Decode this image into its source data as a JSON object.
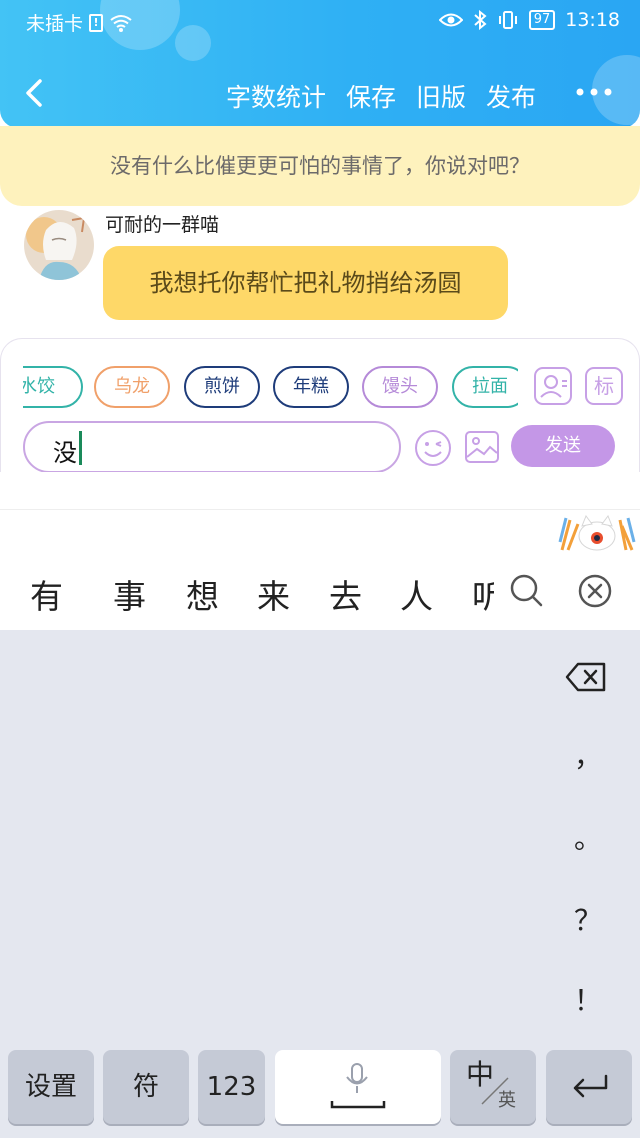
{
  "status_bar": {
    "carrier": "未插卡",
    "battery": "97",
    "time": "13:18"
  },
  "nav": {
    "back_icon": "chevron-left-icon",
    "actions": [
      "字数统计",
      "保存",
      "旧版",
      "发布"
    ],
    "more_icon": "more-dots-icon"
  },
  "notice": {
    "text": "没有什么比催更更可怕的事情了，你说对吧？"
  },
  "chat": {
    "sender_name": "可耐的一群喵",
    "message": "我想托你帮忙把礼物捎给汤圆"
  },
  "quick_tags": [
    {
      "label": "水饺",
      "color": "#33b3a8"
    },
    {
      "label": "乌龙",
      "color": "#f0a06a"
    },
    {
      "label": "煎饼",
      "color": "#1e3c7a"
    },
    {
      "label": "年糕",
      "color": "#1e3c7a"
    },
    {
      "label": "馒头",
      "color": "#b58ad8"
    },
    {
      "label": "拉面",
      "color": "#33b3a8"
    }
  ],
  "side_icons": {
    "profile": "person-card-icon",
    "tag_label": "标"
  },
  "input": {
    "value": "没",
    "send_label": "发送"
  },
  "candidates": [
    "有",
    "事",
    "想",
    "来",
    "去",
    "人",
    "听"
  ],
  "keyboard": {
    "punctuation": [
      "，",
      "。",
      "？",
      "！"
    ],
    "bottom_keys": {
      "settings": "设置",
      "symbols": "符",
      "numbers": "123",
      "lang_main": "中",
      "lang_alt": "英"
    }
  },
  "colors": {
    "header": "#2fb0f4",
    "notice_bg": "#fef2bd",
    "bubble": "#fed868",
    "accent": "#c497e7",
    "keyboard_bg": "#e4e7ef"
  }
}
